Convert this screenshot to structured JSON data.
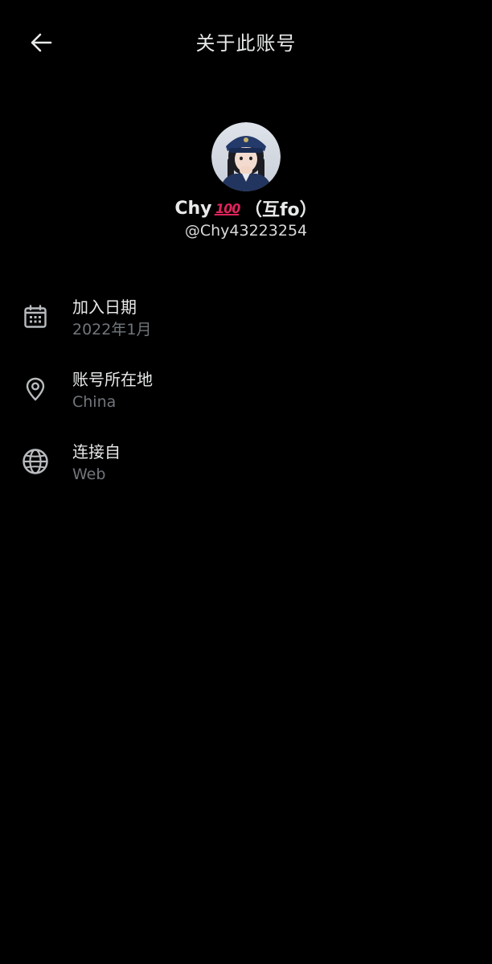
{
  "header": {
    "title": "关于此账号",
    "back_icon": "back-arrow-icon"
  },
  "profile": {
    "display_name": "Chy",
    "badge_text": "100",
    "display_name_suffix": "（互fo）",
    "handle": "@Chy43223254"
  },
  "info": [
    {
      "icon": "calendar-icon",
      "label": "加入日期",
      "value": "2022年1月"
    },
    {
      "icon": "location-pin-icon",
      "label": "账号所在地",
      "value": "China"
    },
    {
      "icon": "globe-icon",
      "label": "连接自",
      "value": "Web"
    }
  ],
  "colors": {
    "background": "#000000",
    "primary_text": "#e7e9ea",
    "secondary_text": "#71767b",
    "badge": "#e0245e"
  }
}
